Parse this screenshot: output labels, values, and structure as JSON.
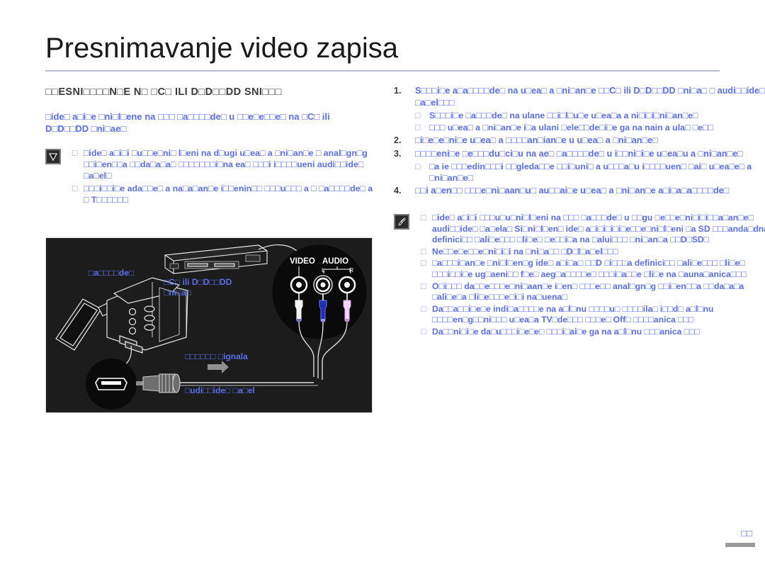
{
  "document": {
    "title": "Presnimavanje video zapisa",
    "page_number": "□□"
  },
  "left_column": {
    "section_heading": "□□ESNI□□□□N□E N□ □C□ ILI D□D□□DD SNI□□□",
    "intro": "□ide□ a□i□e □ni□l□ene na □□□ □a□□□□de□ u □□e□e□□e□ na □C□ ili D□D□□DD □ni□ae□",
    "note": {
      "icon": "warning-chevron-icon",
      "items": [
        "□ide□ a□i□i □u□□e□ni□ l□eni na d□ugi u□ea□ a □ni□an□e □ anal□gn□g □□i□en□□a □□da□a□a□ □□□□□□□i□na ea□ □□□i i□□□□ueni audi□□ide□ □a□el□",
        "□□□i□□i□e ada□□e□ a na□a□an□e i□□enin□□ □□□u□□□ a □ □a□□□□de□ a □ T□□□□□□"
      ]
    },
    "figure": {
      "labels": {
        "camcorder": "□a□□□□de□",
        "vcr": "□C□ ili D□D□□DD\n□ni□a□",
        "signal_flow": "□□□□□□ □ignala",
        "cable": "□udi□□ide□ □a□el"
      },
      "jack_labels": {
        "video": "VIDEO",
        "audio": "AUDIO",
        "left": "L",
        "right": "R"
      },
      "colors": {
        "background": "#1c1c1c",
        "label": "#5b6ee8",
        "video_jack": "#ffffff",
        "audio_left_jack": "#3b4cd8",
        "audio_right_jack": "#e8c8f0"
      }
    }
  },
  "right_column": {
    "steps": [
      {
        "number": "1.",
        "text": "S□□□i□e a□a□□□□de□ na u□ea□ a □ni□an□e □□C□ ili D□D□□DD □ni□a□ □ audi□□ide□ □a□el□□□",
        "substeps": [
          "S□□□i□e □a□□□de□ na ulane □□i□l□u□e u□ea□a a ni□i□i□ni□an□e□",
          "□□□ u□ea□ a □ni□an□e i□a ulani □ele□□de□i□e ga na nain a ula□ □e□□"
        ]
      },
      {
        "number": "2.",
        "text": "□i□e□e□ni□e u□ea□ a □□□□an□ian□e u u□ea□ a □ni□an□e□",
        "substeps": []
      },
      {
        "number": "3.",
        "text": "□□□□eni□e □e□□□du□ci□u na ae□ □a□□□□de□ u i□□ni□i□e u□ea□u a □ni□an□e□",
        "substeps": [
          "□a ie □□□edin□□□i □□gleda□□e □□i□uni□ a u□□□a□u i□□□□uen□ □ai□ u□ea□e□ a □ni□an□e□"
        ]
      },
      {
        "number": "4.",
        "text": "□□i a□en□□ □□□e□ni□aan□u□ au□□ai□e u□ea□ a □ni□an□e a□i□a□a□□□□de□",
        "substeps": []
      }
    ],
    "note": {
      "icon": "pencil-note-icon",
      "items": [
        "□ide□ a□i□i □□□u□u□ni□l□eni na □□□ □a□□□de□ u □□gu □e□□e□ni□i□i□□a□an□e□ audi□□ide□ □a□ela□ Si□ni□l□en□ ide□ a□i□i□i□i□e□□e□ni□l□eni □a SD □□□anda□dna definici□□ □ali□e□□□ □li□e□ □e□□i□a na □alui□□□ □ni□an□a □□D□SD□",
        "Ne□□e□e□□e□ni□i□i na □ni□a□□ □D□l□a□el□□□",
        "□a□□□i□an□e □ni□l□en□g ide□ a□i□a□ □□D □i□□□a definici□□ □ali□e□□□ □li□e□ □□□i□□i□e ug□aeni□□ f□e□ aeg□a□□□□e□ □□□i□a□□e □li□e na □auna□anica□□□",
        "O□i□□□ da□□e□□□e□ni□aan□e i□en□ □□□e□□ anal□gn□g □□i□en□□a □□da□a□a □ali□e□a □li□e□□□e□i□i na□uena□",
        "Da□□a□□i□e□e indi□a□□□□e na a□l□nu □□□□u□ □□□□ila□ i□□d□ a□l□nu □□□□en□g□□ni□□□ u□ea□a TV□de□□□ □□□e□ Off□ □□□□anica □□□",
        "Da□□ni□i□e da□u□□□i□e□e□ □□□i□ai□e ga na a□l□nu □□□anica □□□"
      ]
    }
  }
}
